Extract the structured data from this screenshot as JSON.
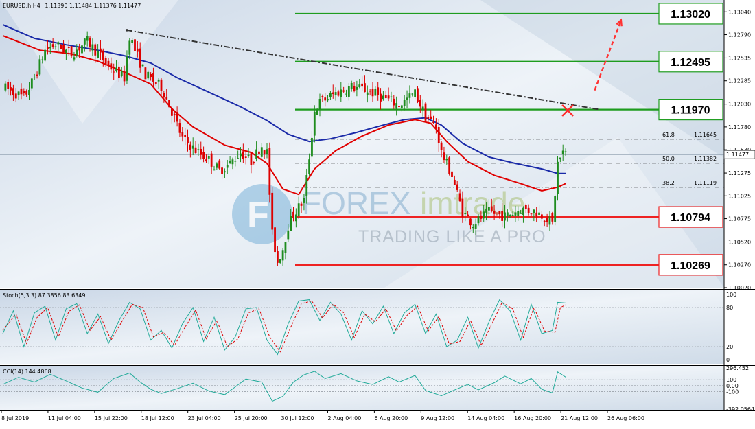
{
  "header": {
    "symbol": "EURUSD.h,H4",
    "ohlc": "1.11390 1.11484 1.11376 1.11477"
  },
  "colors": {
    "background_tint": "#dfe8f2",
    "bull_candle": "#1e8c1e",
    "bear_candle": "#dd0000",
    "ma_fast": "#e00000",
    "ma_slow": "#1a2aa8",
    "resistance_level": "#1e9c1e",
    "support_level": "#ee2222",
    "trendline": "#333333",
    "forecast_arrow": "#ff3333",
    "stoch_main": "#22aa99",
    "stoch_signal": "#dd0000",
    "cci_line": "#22aa99"
  },
  "watermark": {
    "brand_left": "FOREX",
    "brand_right": "imtrade",
    "tagline": "TRADING LIKE A PRO"
  },
  "chart_data": [
    {
      "panel": "price",
      "type": "candlestick",
      "current_price": 1.11477,
      "current_price_label": "1.11477",
      "y_axis_ticks": [
        "1.13040",
        "1.12790",
        "1.12535",
        "1.12285",
        "1.12030",
        "1.11780",
        "1.11530",
        "1.11275",
        "1.11025",
        "1.10775",
        "1.10520",
        "1.10270",
        "1.10020"
      ],
      "y_range": [
        1.1002,
        1.1317
      ],
      "x_axis_ticks": [
        "8 Jul 2019",
        "11 Jul 04:00",
        "15 Jul 22:00",
        "18 Jul 12:00",
        "23 Jul 04:00",
        "25 Jul 20:00",
        "30 Jul 12:00",
        "2 Aug 04:00",
        "6 Aug 20:00",
        "9 Aug 12:00",
        "14 Aug 04:00",
        "16 Aug 20:00",
        "21 Aug 12:00",
        "26 Aug 06:00"
      ],
      "levels": [
        {
          "label": "1.13020",
          "value": 1.1302,
          "kind": "resistance"
        },
        {
          "label": "1.12495",
          "value": 1.12495,
          "kind": "resistance"
        },
        {
          "label": "1.11970",
          "value": 1.1197,
          "kind": "resistance"
        },
        {
          "label": "1.10794",
          "value": 1.10794,
          "kind": "support"
        },
        {
          "label": "1.10269",
          "value": 1.10269,
          "kind": "support"
        }
      ],
      "fibonacci": [
        {
          "label": "61.8",
          "value_label": "1.11645",
          "value": 1.11645
        },
        {
          "label": "50.0",
          "value_label": "1.11382",
          "value": 1.11382
        },
        {
          "label": "38.2",
          "value_label": "1.11119",
          "value": 1.11119
        }
      ],
      "trendline": {
        "from": {
          "bar": 47,
          "price": 1.1284
        },
        "to": {
          "bar": 226,
          "price": 1.1197
        }
      },
      "price_path": [
        [
          0,
          1.1222
        ],
        [
          8,
          1.121
        ],
        [
          12,
          1.1232
        ],
        [
          16,
          1.1262
        ],
        [
          20,
          1.1268
        ],
        [
          26,
          1.1258
        ],
        [
          32,
          1.1272
        ],
        [
          40,
          1.1245
        ],
        [
          46,
          1.1232
        ],
        [
          48,
          1.1278
        ],
        [
          50,
          1.1262
        ],
        [
          54,
          1.1235
        ],
        [
          60,
          1.1222
        ],
        [
          64,
          1.1195
        ],
        [
          68,
          1.1165
        ],
        [
          74,
          1.115
        ],
        [
          78,
          1.1142
        ],
        [
          82,
          1.113
        ],
        [
          86,
          1.1138
        ],
        [
          90,
          1.115
        ],
        [
          94,
          1.114
        ],
        [
          98,
          1.1158
        ],
        [
          100,
          1.115
        ],
        [
          102,
          1.106
        ],
        [
          104,
          1.103
        ],
        [
          106,
          1.1045
        ],
        [
          108,
          1.107
        ],
        [
          110,
          1.1082
        ],
        [
          114,
          1.1098
        ],
        [
          116,
          1.1145
        ],
        [
          118,
          1.1195
        ],
        [
          120,
          1.1205
        ],
        [
          126,
          1.1215
        ],
        [
          132,
          1.1222
        ],
        [
          138,
          1.1218
        ],
        [
          144,
          1.121
        ],
        [
          150,
          1.1202
        ],
        [
          156,
          1.1215
        ],
        [
          160,
          1.119
        ],
        [
          164,
          1.1178
        ],
        [
          166,
          1.115
        ],
        [
          170,
          1.1125
        ],
        [
          174,
          1.1085
        ],
        [
          178,
          1.1072
        ],
        [
          184,
          1.1085
        ],
        [
          190,
          1.108
        ],
        [
          196,
          1.1088
        ],
        [
          202,
          1.1085
        ],
        [
          206,
          1.1078
        ],
        [
          208,
          1.1072
        ],
        [
          210,
          1.1138
        ],
        [
          212,
          1.115
        ],
        [
          213,
          1.1148
        ]
      ],
      "ma_fast_path": [
        [
          0,
          1.1278
        ],
        [
          14,
          1.1262
        ],
        [
          26,
          1.1258
        ],
        [
          36,
          1.125
        ],
        [
          46,
          1.1238
        ],
        [
          56,
          1.1225
        ],
        [
          64,
          1.1198
        ],
        [
          72,
          1.1178
        ],
        [
          84,
          1.1158
        ],
        [
          94,
          1.115
        ],
        [
          100,
          1.1138
        ],
        [
          106,
          1.111
        ],
        [
          112,
          1.1104
        ],
        [
          118,
          1.1132
        ],
        [
          126,
          1.1152
        ],
        [
          136,
          1.1168
        ],
        [
          146,
          1.118
        ],
        [
          156,
          1.1186
        ],
        [
          162,
          1.1182
        ],
        [
          168,
          1.1162
        ],
        [
          176,
          1.114
        ],
        [
          186,
          1.1125
        ],
        [
          196,
          1.1116
        ],
        [
          204,
          1.1108
        ],
        [
          210,
          1.1112
        ],
        [
          213,
          1.1116
        ]
      ],
      "ma_slow_path": [
        [
          0,
          1.129
        ],
        [
          12,
          1.1275
        ],
        [
          24,
          1.1268
        ],
        [
          36,
          1.1262
        ],
        [
          46,
          1.1256
        ],
        [
          56,
          1.1248
        ],
        [
          66,
          1.1232
        ],
        [
          78,
          1.1216
        ],
        [
          90,
          1.12
        ],
        [
          100,
          1.1185
        ],
        [
          108,
          1.117
        ],
        [
          116,
          1.1162
        ],
        [
          124,
          1.1165
        ],
        [
          134,
          1.1172
        ],
        [
          144,
          1.118
        ],
        [
          152,
          1.1186
        ],
        [
          160,
          1.1188
        ],
        [
          166,
          1.118
        ],
        [
          174,
          1.116
        ],
        [
          184,
          1.1145
        ],
        [
          194,
          1.1138
        ],
        [
          204,
          1.1132
        ],
        [
          210,
          1.1127
        ],
        [
          213,
          1.1127
        ]
      ],
      "forecast_arrow": {
        "from": {
          "bar": 224,
          "price": 1.1218
        },
        "to": {
          "bar": 234,
          "price": 1.1295
        }
      }
    },
    {
      "panel": "stochastic",
      "type": "line",
      "label": "Stoch(5,3,3) 87.3856 83.6349",
      "y_axis_ticks": [
        "100",
        "80",
        "20",
        "0"
      ],
      "y_range": [
        0,
        100
      ],
      "levels": [
        80,
        20
      ],
      "main_path": [
        [
          0,
          40
        ],
        [
          4,
          75
        ],
        [
          8,
          20
        ],
        [
          12,
          72
        ],
        [
          16,
          82
        ],
        [
          20,
          30
        ],
        [
          24,
          78
        ],
        [
          28,
          86
        ],
        [
          32,
          40
        ],
        [
          36,
          70
        ],
        [
          40,
          25
        ],
        [
          44,
          60
        ],
        [
          48,
          88
        ],
        [
          52,
          78
        ],
        [
          56,
          30
        ],
        [
          60,
          45
        ],
        [
          64,
          18
        ],
        [
          68,
          55
        ],
        [
          72,
          80
        ],
        [
          76,
          28
        ],
        [
          80,
          65
        ],
        [
          84,
          15
        ],
        [
          88,
          35
        ],
        [
          92,
          78
        ],
        [
          96,
          80
        ],
        [
          100,
          30
        ],
        [
          104,
          8
        ],
        [
          108,
          55
        ],
        [
          112,
          90
        ],
        [
          116,
          92
        ],
        [
          120,
          60
        ],
        [
          124,
          88
        ],
        [
          128,
          70
        ],
        [
          132,
          30
        ],
        [
          136,
          75
        ],
        [
          140,
          55
        ],
        [
          144,
          82
        ],
        [
          148,
          40
        ],
        [
          152,
          72
        ],
        [
          156,
          85
        ],
        [
          160,
          40
        ],
        [
          164,
          70
        ],
        [
          168,
          20
        ],
        [
          172,
          30
        ],
        [
          176,
          65
        ],
        [
          180,
          18
        ],
        [
          184,
          58
        ],
        [
          188,
          92
        ],
        [
          192,
          75
        ],
        [
          196,
          30
        ],
        [
          200,
          85
        ],
        [
          204,
          40
        ],
        [
          208,
          45
        ],
        [
          210,
          88
        ],
        [
          213,
          87
        ]
      ],
      "signal_path": [
        [
          0,
          45
        ],
        [
          5,
          70
        ],
        [
          9,
          25
        ],
        [
          13,
          65
        ],
        [
          17,
          80
        ],
        [
          21,
          35
        ],
        [
          25,
          74
        ],
        [
          29,
          84
        ],
        [
          33,
          45
        ],
        [
          37,
          66
        ],
        [
          41,
          30
        ],
        [
          45,
          58
        ],
        [
          49,
          85
        ],
        [
          53,
          80
        ],
        [
          57,
          35
        ],
        [
          61,
          42
        ],
        [
          65,
          22
        ],
        [
          69,
          50
        ],
        [
          73,
          76
        ],
        [
          77,
          32
        ],
        [
          81,
          60
        ],
        [
          85,
          20
        ],
        [
          89,
          32
        ],
        [
          93,
          72
        ],
        [
          97,
          78
        ],
        [
          101,
          35
        ],
        [
          105,
          12
        ],
        [
          109,
          50
        ],
        [
          113,
          86
        ],
        [
          117,
          90
        ],
        [
          121,
          64
        ],
        [
          125,
          85
        ],
        [
          129,
          72
        ],
        [
          133,
          34
        ],
        [
          137,
          70
        ],
        [
          141,
          58
        ],
        [
          145,
          78
        ],
        [
          149,
          44
        ],
        [
          153,
          68
        ],
        [
          157,
          82
        ],
        [
          161,
          44
        ],
        [
          165,
          66
        ],
        [
          169,
          24
        ],
        [
          173,
          28
        ],
        [
          177,
          60
        ],
        [
          181,
          22
        ],
        [
          185,
          54
        ],
        [
          189,
          88
        ],
        [
          193,
          78
        ],
        [
          197,
          34
        ],
        [
          201,
          80
        ],
        [
          205,
          44
        ],
        [
          209,
          42
        ],
        [
          211,
          80
        ],
        [
          213,
          84
        ]
      ]
    },
    {
      "panel": "cci",
      "type": "line",
      "label": "CCI(14) 144.4868",
      "y_axis_ticks": [
        "296.452",
        "100",
        "0.00",
        "-100",
        "-392.0564"
      ],
      "y_range": [
        -392.0564,
        296.452
      ],
      "levels": [
        100,
        0,
        -100
      ],
      "main_path": [
        [
          0,
          20
        ],
        [
          6,
          140
        ],
        [
          12,
          60
        ],
        [
          18,
          190
        ],
        [
          24,
          80
        ],
        [
          30,
          -40
        ],
        [
          36,
          -110
        ],
        [
          42,
          120
        ],
        [
          48,
          210
        ],
        [
          52,
          60
        ],
        [
          56,
          -60
        ],
        [
          60,
          -130
        ],
        [
          66,
          -50
        ],
        [
          72,
          40
        ],
        [
          78,
          -90
        ],
        [
          84,
          -150
        ],
        [
          88,
          -20
        ],
        [
          92,
          110
        ],
        [
          98,
          60
        ],
        [
          102,
          -260
        ],
        [
          106,
          -180
        ],
        [
          110,
          60
        ],
        [
          114,
          180
        ],
        [
          118,
          240
        ],
        [
          122,
          120
        ],
        [
          128,
          200
        ],
        [
          134,
          80
        ],
        [
          140,
          20
        ],
        [
          146,
          150
        ],
        [
          150,
          60
        ],
        [
          156,
          170
        ],
        [
          160,
          -80
        ],
        [
          166,
          -170
        ],
        [
          170,
          -90
        ],
        [
          176,
          20
        ],
        [
          180,
          -70
        ],
        [
          186,
          50
        ],
        [
          190,
          160
        ],
        [
          196,
          30
        ],
        [
          200,
          120
        ],
        [
          204,
          -60
        ],
        [
          208,
          -120
        ],
        [
          210,
          230
        ],
        [
          213,
          144
        ]
      ]
    }
  ]
}
